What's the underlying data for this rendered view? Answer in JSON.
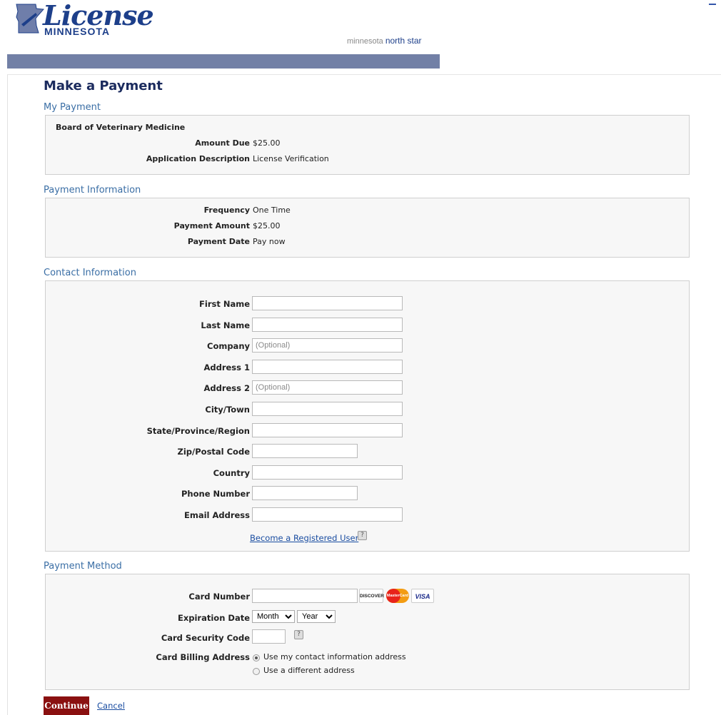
{
  "header": {
    "logo_word": "License",
    "logo_state": "MINNESOTA",
    "northstar_prefix": "minnesota",
    "northstar_brand": "north star"
  },
  "page_title": "Make a Payment",
  "my_payment": {
    "section_title": "My Payment",
    "board": "Board of Veterinary Medicine",
    "amount_due_label": "Amount Due",
    "amount_due_value": "$25.00",
    "app_desc_label": "Application Description",
    "app_desc_value": "License Verification"
  },
  "payment_info": {
    "section_title": "Payment Information",
    "frequency_label": "Frequency",
    "frequency_value": "One Time",
    "payment_amount_label": "Payment Amount",
    "payment_amount_value": "$25.00",
    "payment_date_label": "Payment Date",
    "payment_date_value": "Pay now"
  },
  "contact_info": {
    "section_title": "Contact Information",
    "fields": {
      "first_name": {
        "label": "First Name",
        "placeholder": ""
      },
      "last_name": {
        "label": "Last Name",
        "placeholder": ""
      },
      "company": {
        "label": "Company",
        "placeholder": "(Optional)"
      },
      "address1": {
        "label": "Address 1",
        "placeholder": ""
      },
      "address2": {
        "label": "Address 2",
        "placeholder": "(Optional)"
      },
      "city": {
        "label": "City/Town",
        "placeholder": ""
      },
      "state": {
        "label": "State/Province/Region",
        "placeholder": ""
      },
      "zip": {
        "label": "Zip/Postal Code",
        "placeholder": ""
      },
      "country": {
        "label": "Country",
        "placeholder": ""
      },
      "phone": {
        "label": "Phone Number",
        "placeholder": ""
      },
      "email": {
        "label": "Email Address",
        "placeholder": ""
      }
    },
    "register_link": "Become a Registered User"
  },
  "payment_method": {
    "section_title": "Payment Method",
    "card_number_label": "Card Number",
    "card_logos": {
      "discover": "DISCOVER",
      "mastercard": "MasterCard",
      "visa": "VISA"
    },
    "expiration_label": "Expiration Date",
    "month_selected": "Month",
    "year_selected": "Year",
    "security_code_label": "Card Security Code",
    "billing_label": "Card Billing Address",
    "billing_option_1": "Use my contact information address",
    "billing_option_2": "Use a different address",
    "billing_selected": 1
  },
  "actions": {
    "continue_label": "Continue",
    "cancel_label": "Cancel"
  },
  "colors": {
    "brand_blue": "#1d3f8a",
    "nav_bar": "#7280a6",
    "section_title": "#3a6ea5",
    "continue_bg": "#8a1010"
  },
  "icons": {
    "help": "help-icon",
    "logo_map": "minnesota-map-icon"
  }
}
